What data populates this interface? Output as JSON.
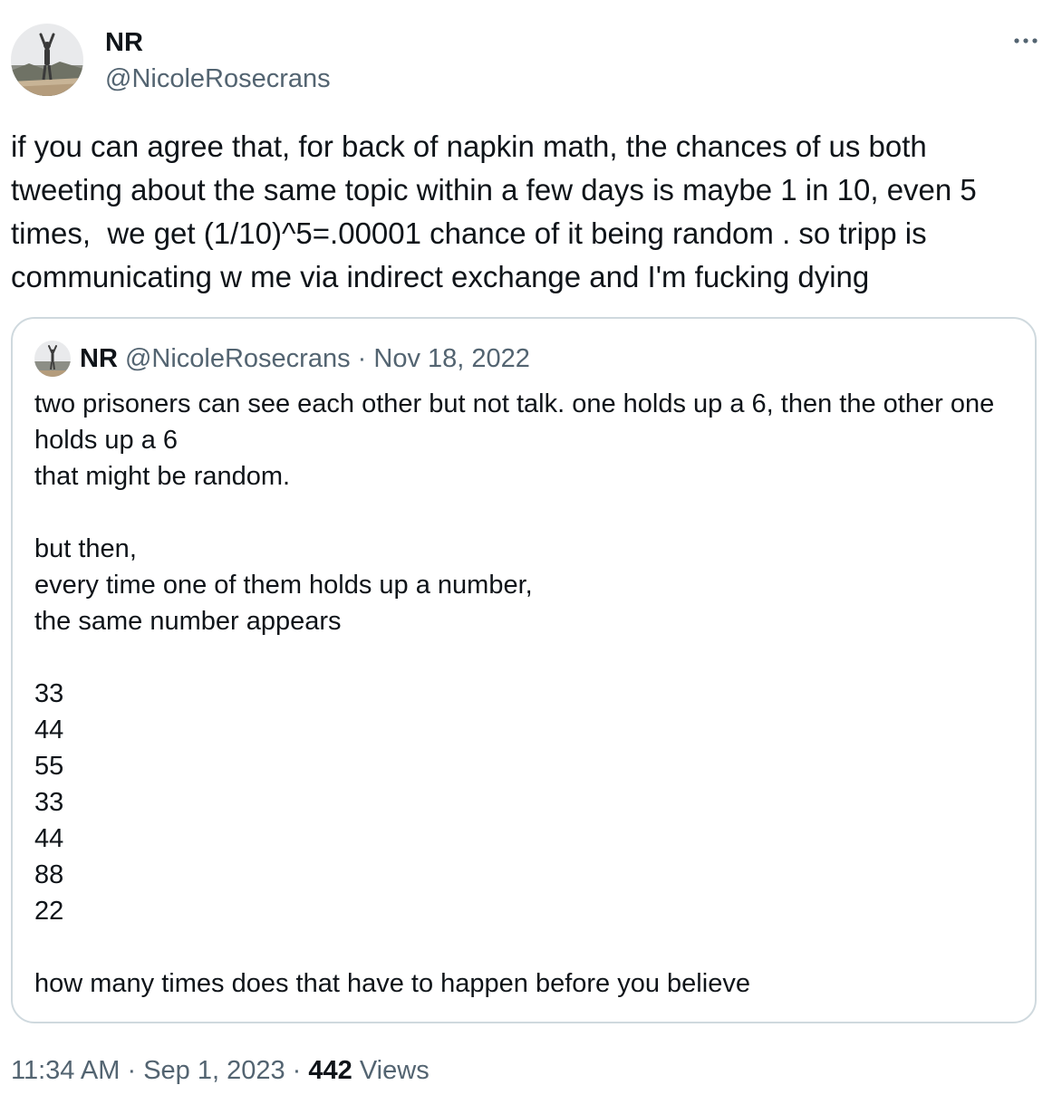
{
  "author": {
    "name": "NR",
    "handle": "@NicoleRosecrans",
    "avatar": "avatar-photo"
  },
  "menu_icon": "more-horizontal-icon",
  "tweet_text": "if you can agree that, for back of napkin math, the chances of us both tweeting about the same topic within a few days is maybe 1 in 10, even 5 times,  we get (1/10)^5=.00001 chance of it being random . so tripp is communicating w me via indirect exchange and I'm fucking dying",
  "quoted_tweet": {
    "name": "NR",
    "handle": "@NicoleRosecrans",
    "separator": "·",
    "date": "Nov 18, 2022",
    "text": "two prisoners can see each other but not talk. one holds up a 6, then the other one holds up a 6\nthat might be random.\n\nbut then,\nevery time one of them holds up a number,\nthe same number appears\n\n33\n44\n55\n33\n44\n88\n22\n\nhow many times does that have to happen before you believe"
  },
  "meta": {
    "time": "11:34 AM",
    "separator": "·",
    "date": "Sep 1, 2023",
    "views_count": "442",
    "views_label": "Views"
  },
  "colors": {
    "text_primary": "#0f1419",
    "text_secondary": "#536471",
    "border": "#cfd9de"
  }
}
